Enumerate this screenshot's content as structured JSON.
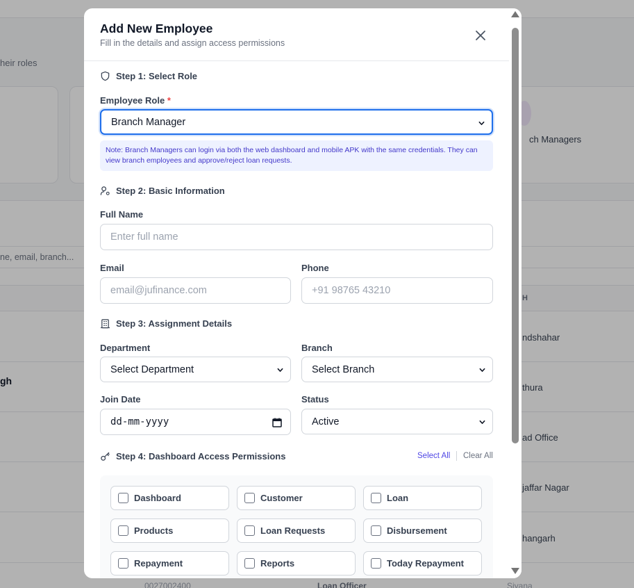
{
  "background": {
    "subtitle_fragment": "heir roles",
    "card_label_fragment": "ch Managers",
    "search_placeholder_fragment": "ne, email, branch...",
    "column_header_fragment": "H",
    "row_name_fragment": "gh",
    "branches": [
      "ndshahar",
      "thura",
      "ad Office",
      "jaffar Nagar",
      "hangarh"
    ],
    "bottom_phone_fragment": "0027002400",
    "bottom_role_fragment": "Loan Officer",
    "bottom_branch_fragment": "Siyana"
  },
  "modal": {
    "title": "Add New Employee",
    "subtitle": "Fill in the details and assign access permissions",
    "close_icon": "close-icon",
    "step1": {
      "label": "Step 1: Select Role",
      "icon": "shield-icon"
    },
    "role": {
      "label": "Employee Role",
      "required_mark": "*",
      "value": "Branch Manager",
      "note": "Note: Branch Managers can login via both the web dashboard and mobile APK with the same credentials. They can view branch employees and approve/reject loan requests."
    },
    "step2": {
      "label": "Step 2: Basic Information",
      "icon": "user-gear-icon"
    },
    "full_name": {
      "label": "Full Name",
      "placeholder": "Enter full name"
    },
    "email": {
      "label": "Email",
      "placeholder": "email@jufinance.com"
    },
    "phone": {
      "label": "Phone",
      "placeholder": "+91 98765 43210"
    },
    "step3": {
      "label": "Step 3: Assignment Details",
      "icon": "building-icon"
    },
    "department": {
      "label": "Department",
      "value": "Select Department"
    },
    "branch": {
      "label": "Branch",
      "value": "Select Branch"
    },
    "join_date": {
      "label": "Join Date",
      "value": "dd-mm-yyyy"
    },
    "status": {
      "label": "Status",
      "value": "Active"
    },
    "step4": {
      "label": "Step 4: Dashboard Access Permissions",
      "icon": "key-icon"
    },
    "select_all": "Select All",
    "clear_all": "Clear All",
    "permissions": [
      {
        "label": "Dashboard",
        "checked": false
      },
      {
        "label": "Customer",
        "checked": false
      },
      {
        "label": "Loan",
        "checked": false
      },
      {
        "label": "Products",
        "checked": false
      },
      {
        "label": "Loan Requests",
        "checked": false
      },
      {
        "label": "Disbursement",
        "checked": false
      },
      {
        "label": "Repayment",
        "checked": false
      },
      {
        "label": "Reports",
        "checked": false
      },
      {
        "label": "Today Repayment",
        "checked": false
      }
    ]
  },
  "colors": {
    "accent": "#4f46e5",
    "focus_border": "#1f6feb",
    "required": "#ef4444",
    "note_bg": "#eef2ff"
  }
}
